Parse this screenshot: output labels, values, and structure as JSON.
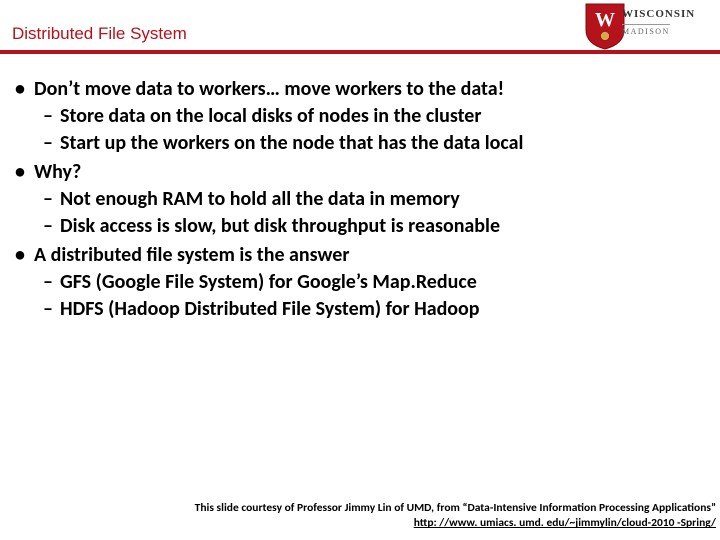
{
  "header": {
    "title": "Distributed File System",
    "crest": {
      "line1": "WISCONSIN",
      "line2": "MADISON"
    }
  },
  "bullets": [
    {
      "text": "Don’t move data to workers… move workers to the data!",
      "sub": [
        "Store data on the local disks of nodes in the cluster",
        "Start up the workers on the node that has the data local"
      ]
    },
    {
      "text": "Why?",
      "sub": [
        "Not enough RAM to hold all the data in memory",
        "Disk access is slow, but disk throughput is reasonable"
      ]
    },
    {
      "text": "A distributed file system is the answer",
      "sub": [
        "GFS (Google File System) for Google’s Map.Reduce",
        "HDFS (Hadoop Distributed File System) for Hadoop"
      ]
    }
  ],
  "footer": {
    "line1": "This slide courtesy of Professor Jimmy Lin of UMD, from “Data-Intensive Information Processing Applications”",
    "link_text": "http: //www. umiacs. umd. edu/~jimmylin/cloud-2010 -Spring/"
  }
}
